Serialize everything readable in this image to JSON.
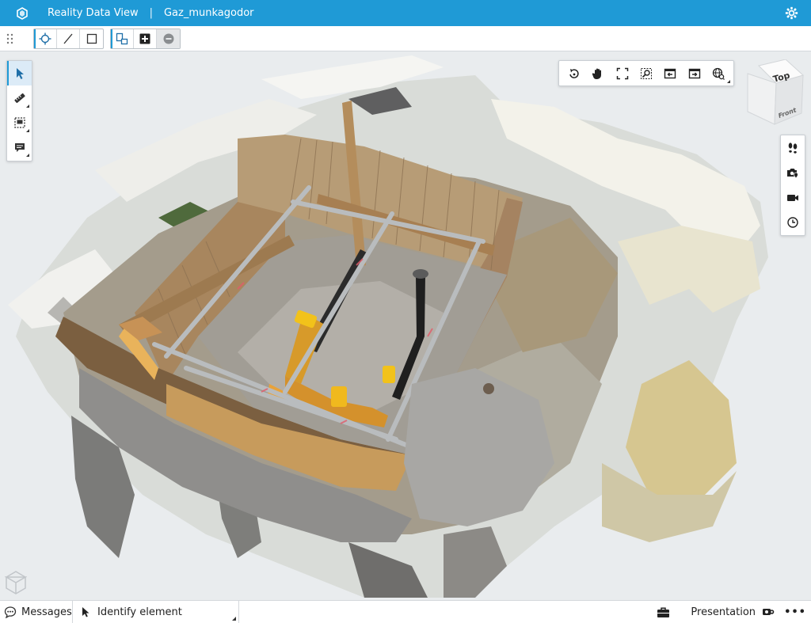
{
  "app": {
    "title": "Reality Data View",
    "separator": "|",
    "document": "Gaz_munkagodor",
    "accent_color": "#1f9ad6"
  },
  "header": {
    "logo_icon": "hexagon-logo-icon",
    "settings_icon": "gear-icon"
  },
  "toolbar": {
    "snap_group": [
      "snap-point-icon",
      "line-icon",
      "rectangle-icon"
    ],
    "edit_group": [
      "select-shapes-icon",
      "add-icon",
      "remove-icon"
    ]
  },
  "left_tools": [
    "pointer-icon",
    "measure-icon",
    "section-box-icon",
    "comment-icon"
  ],
  "nav_tools": [
    "rotate-icon",
    "pan-icon",
    "fit-view-icon",
    "zoom-window-icon",
    "previous-view-icon",
    "next-view-icon",
    "globe-icon"
  ],
  "view_cube": {
    "top": "Top",
    "front": "Front"
  },
  "right_panel": [
    "walk-icon",
    "camera-location-icon",
    "video-camera-icon",
    "history-icon"
  ],
  "status": {
    "messages": "Messages",
    "identify": "Identify element",
    "presentation": "Presentation",
    "more": "•••"
  }
}
